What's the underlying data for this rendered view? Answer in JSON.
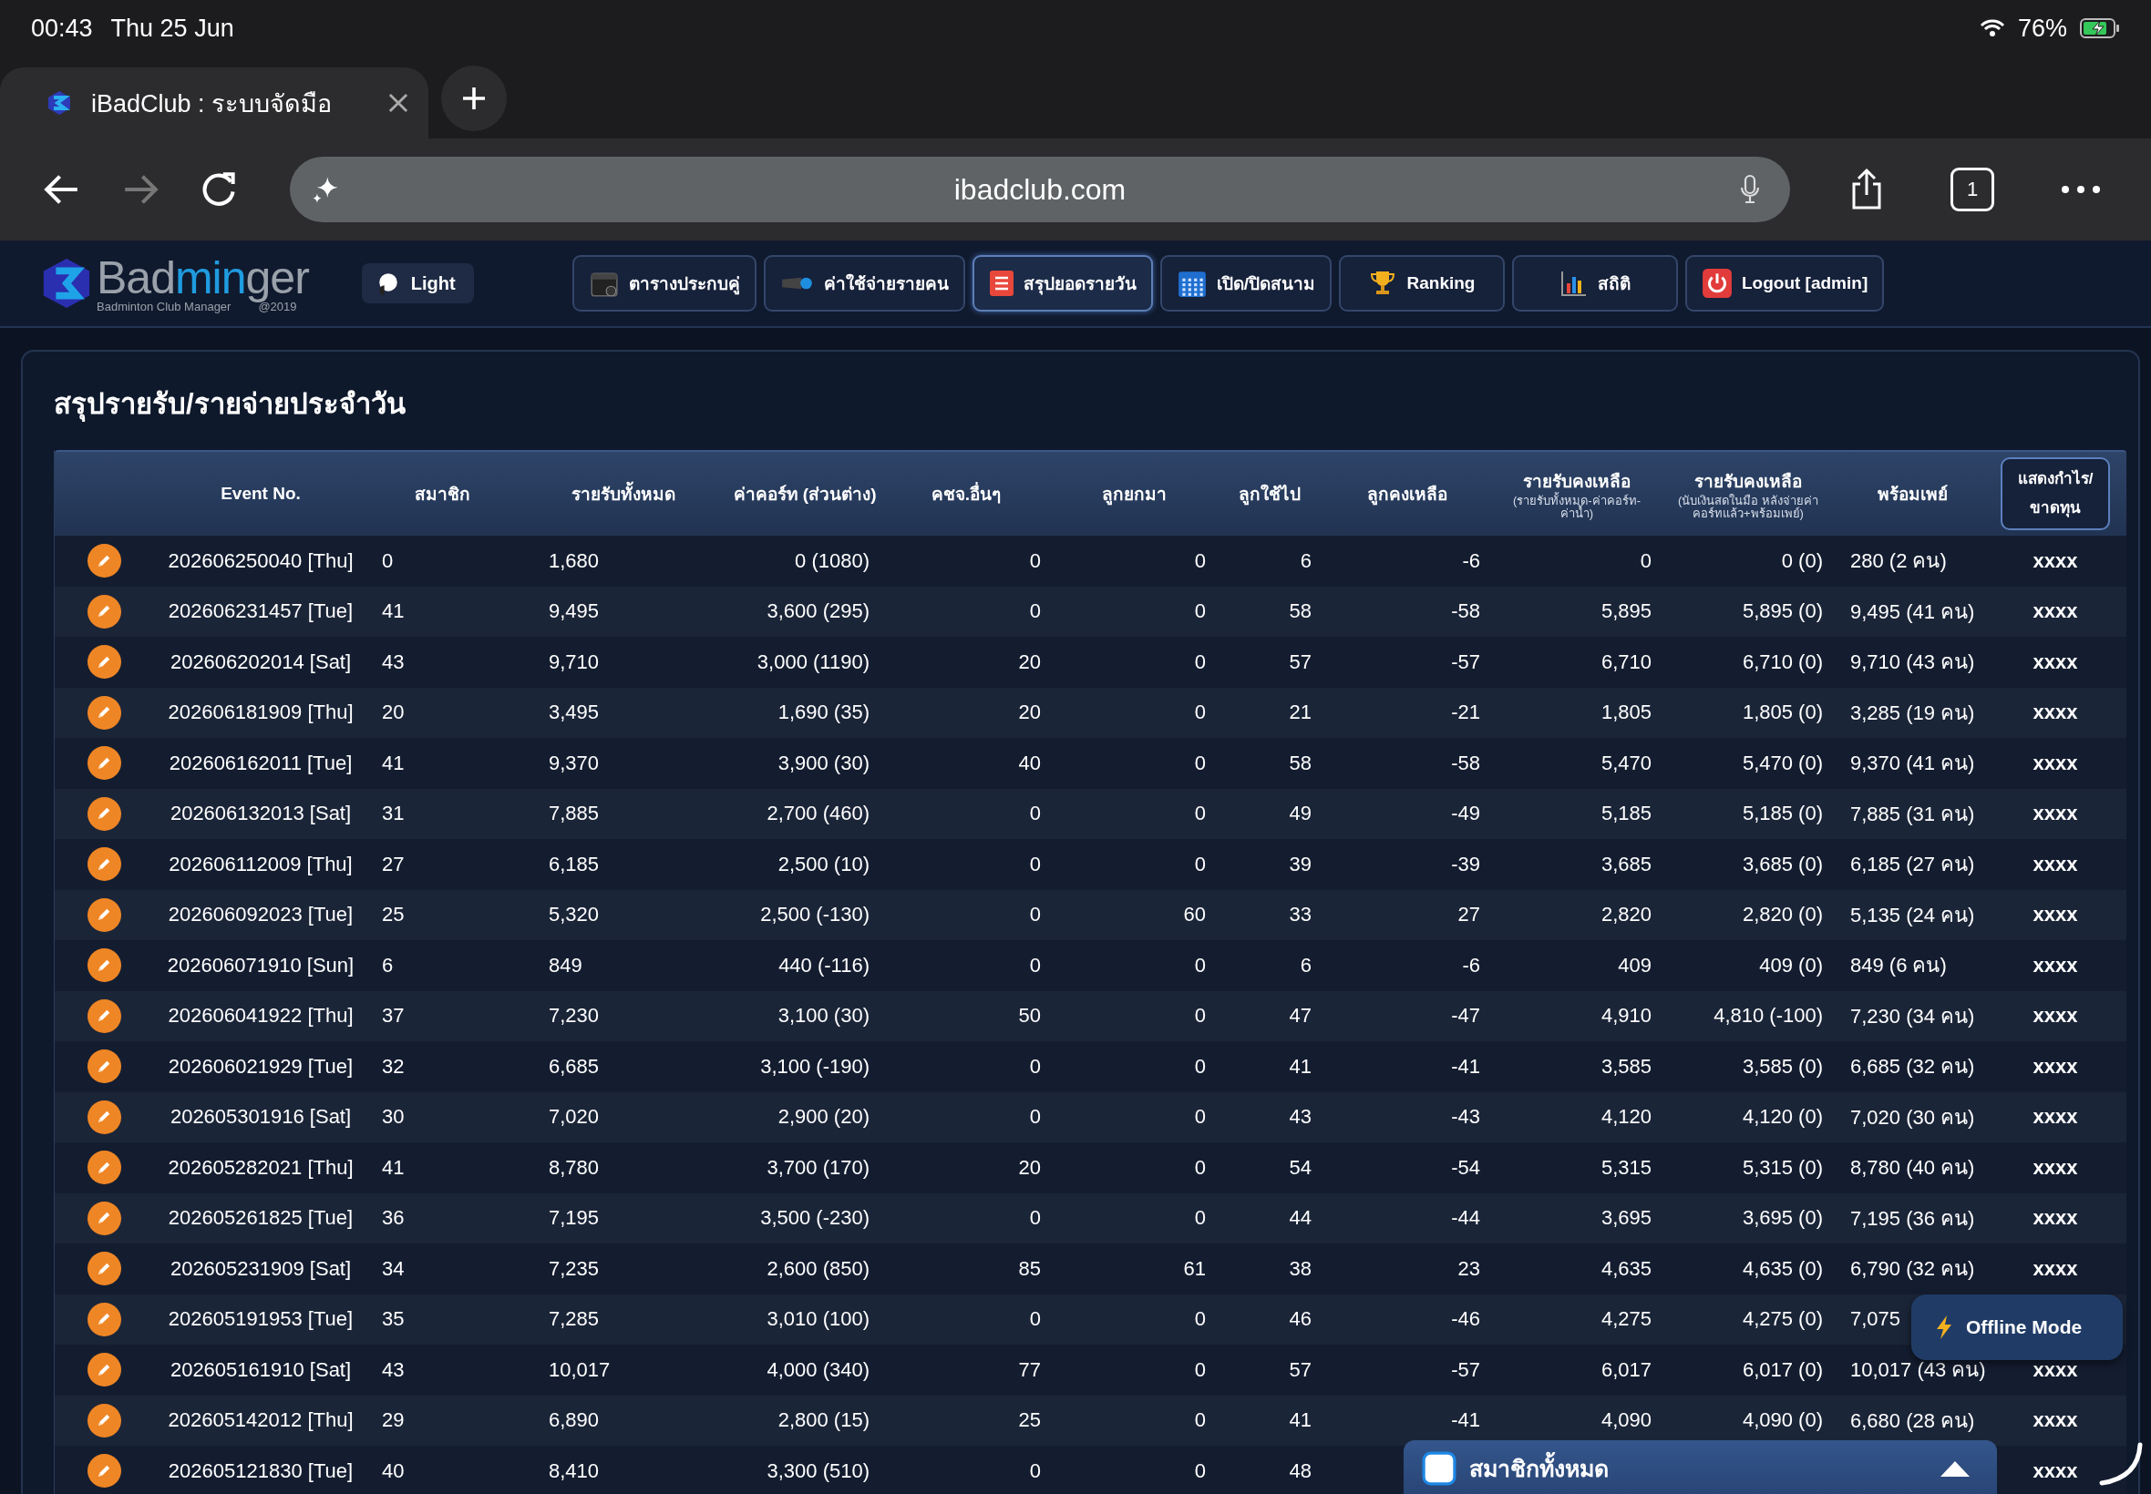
{
  "status_bar": {
    "time": "00:43",
    "date": "Thu 25 Jun",
    "battery": "76%"
  },
  "browser": {
    "tab": {
      "title": "iBadClub : ระบบจัดมือ",
      "selected": true
    },
    "nav_buttons": [
      {
        "kind": "back",
        "disabled": false
      },
      {
        "kind": "forward",
        "disabled": true
      },
      {
        "kind": "reload",
        "disabled": false
      }
    ],
    "url": "ibadclub.com",
    "tab_count": "1"
  },
  "app_header": {
    "logo": [
      {
        "text": "Bad",
        "accent": false
      },
      {
        "text": "min",
        "accent": true
      },
      {
        "text": "ger",
        "accent": false
      }
    ],
    "tagline": "Badminton Club Manager",
    "year": "@2019",
    "theme_toggle": "Light",
    "nav": [
      {
        "label": "ตารางประกบคู่",
        "selected": false
      },
      {
        "label": "ค่าใช้จ่ายรายคน",
        "selected": false
      },
      {
        "label": "สรุปยอดรายวัน",
        "selected": true
      },
      {
        "label": "เปิด/ปิดสนาม",
        "selected": false
      },
      {
        "label": "Ranking",
        "selected": false
      },
      {
        "label": "สถิติ",
        "selected": false
      },
      {
        "label": "Logout [admin]",
        "selected": false
      }
    ]
  },
  "page_title": "สรุปรายรับ/รายจ่ายประจำวัน",
  "table": {
    "columns": [
      {
        "label": "Event No.",
        "kind": "text"
      },
      {
        "label": "สมาชิก",
        "kind": "text"
      },
      {
        "label": "รายรับทั้งหมด",
        "kind": "text"
      },
      {
        "label": "ค่าคอร์ท (ส่วนต่าง)",
        "kind": "text"
      },
      {
        "label": "คชจ.อื่นๆ",
        "kind": "text"
      },
      {
        "label": "ลูกยกมา",
        "kind": "text"
      },
      {
        "label": "ลูกใช้ไป",
        "kind": "text"
      },
      {
        "label": "ลูกคงเหลือ",
        "kind": "text"
      },
      {
        "label": "รายรับคงเหลือ",
        "sublabel": "(รายรับทั้งหมด-ค่าคอร์ท-ค่าน้ำ)",
        "kind": "text"
      },
      {
        "label": "รายรับคงเหลือ",
        "sublabel": "(นับเงินสดในมือ หลังจ่ายค่าคอร์ทแล้ว+พร้อมเพย์)",
        "kind": "text"
      },
      {
        "label": "พร้อมเพย์",
        "kind": "text"
      },
      {
        "label": "แสดงกำไร/ขาดทุน",
        "kind": "button"
      }
    ],
    "rows": [
      [
        "202606250040 [Thu]",
        "0",
        "1,680",
        "0 (1080)",
        "0",
        "0",
        "6",
        "-6",
        "0",
        "0 (0)",
        "280 (2 คน)",
        "xxxx"
      ],
      [
        "202606231457 [Tue]",
        "41",
        "9,495",
        "3,600 (295)",
        "0",
        "0",
        "58",
        "-58",
        "5,895",
        "5,895 (0)",
        "9,495 (41 คน)",
        "xxxx"
      ],
      [
        "202606202014 [Sat]",
        "43",
        "9,710",
        "3,000 (1190)",
        "20",
        "0",
        "57",
        "-57",
        "6,710",
        "6,710 (0)",
        "9,710 (43 คน)",
        "xxxx"
      ],
      [
        "202606181909 [Thu]",
        "20",
        "3,495",
        "1,690 (35)",
        "20",
        "0",
        "21",
        "-21",
        "1,805",
        "1,805 (0)",
        "3,285 (19 คน)",
        "xxxx"
      ],
      [
        "202606162011 [Tue]",
        "41",
        "9,370",
        "3,900 (30)",
        "40",
        "0",
        "58",
        "-58",
        "5,470",
        "5,470 (0)",
        "9,370 (41 คน)",
        "xxxx"
      ],
      [
        "202606132013 [Sat]",
        "31",
        "7,885",
        "2,700 (460)",
        "0",
        "0",
        "49",
        "-49",
        "5,185",
        "5,185 (0)",
        "7,885 (31 คน)",
        "xxxx"
      ],
      [
        "202606112009 [Thu]",
        "27",
        "6,185",
        "2,500 (10)",
        "0",
        "0",
        "39",
        "-39",
        "3,685",
        "3,685 (0)",
        "6,185 (27 คน)",
        "xxxx"
      ],
      [
        "202606092023 [Tue]",
        "25",
        "5,320",
        "2,500 (-130)",
        "0",
        "60",
        "33",
        "27",
        "2,820",
        "2,820 (0)",
        "5,135 (24 คน)",
        "xxxx"
      ],
      [
        "202606071910 [Sun]",
        "6",
        "849",
        "440 (-116)",
        "0",
        "0",
        "6",
        "-6",
        "409",
        "409 (0)",
        "849 (6 คน)",
        "xxxx"
      ],
      [
        "202606041922 [Thu]",
        "37",
        "7,230",
        "3,100 (30)",
        "50",
        "0",
        "47",
        "-47",
        "4,910",
        "4,810 (-100)",
        "7,230 (34 คน)",
        "xxxx"
      ],
      [
        "202606021929 [Tue]",
        "32",
        "6,685",
        "3,100 (-190)",
        "0",
        "0",
        "41",
        "-41",
        "3,585",
        "3,585 (0)",
        "6,685 (32 คน)",
        "xxxx"
      ],
      [
        "202605301916 [Sat]",
        "30",
        "7,020",
        "2,900 (20)",
        "0",
        "0",
        "43",
        "-43",
        "4,120",
        "4,120 (0)",
        "7,020 (30 คน)",
        "xxxx"
      ],
      [
        "202605282021 [Thu]",
        "41",
        "8,780",
        "3,700 (170)",
        "20",
        "0",
        "54",
        "-54",
        "5,315",
        "5,315 (0)",
        "8,780 (40 คน)",
        "xxxx"
      ],
      [
        "202605261825 [Tue]",
        "36",
        "7,195",
        "3,500 (-230)",
        "0",
        "0",
        "44",
        "-44",
        "3,695",
        "3,695 (0)",
        "7,195 (36 คน)",
        "xxxx"
      ],
      [
        "202605231909 [Sat]",
        "34",
        "7,235",
        "2,600 (850)",
        "85",
        "61",
        "38",
        "23",
        "4,635",
        "4,635 (0)",
        "6,790 (32 คน)",
        "xxxx"
      ],
      [
        "202605191953 [Tue]",
        "35",
        "7,285",
        "3,010 (100)",
        "0",
        "0",
        "46",
        "-46",
        "4,275",
        "4,275 (0)",
        "7,075",
        null
      ],
      [
        "202605161910 [Sat]",
        "43",
        "10,017",
        "4,000 (340)",
        "77",
        "0",
        "57",
        "-57",
        "6,017",
        "6,017 (0)",
        "10,017 (43 คน)",
        "xxxx"
      ],
      [
        "202605142012 [Thu]",
        "29",
        "6,890",
        "2,800 (15)",
        "25",
        "0",
        "41",
        "-41",
        "4,090",
        "4,090 (0)",
        "6,680 (28 คน)",
        "xxxx"
      ],
      [
        "202605121830 [Tue]",
        "40",
        "8,410",
        "3,300 (510)",
        "0",
        "0",
        "48",
        null,
        null,
        null,
        null,
        "xxxx"
      ]
    ]
  },
  "offline_badge": "Offline Mode",
  "members_panel": {
    "label": "สมาชิกทั้งหมด"
  }
}
